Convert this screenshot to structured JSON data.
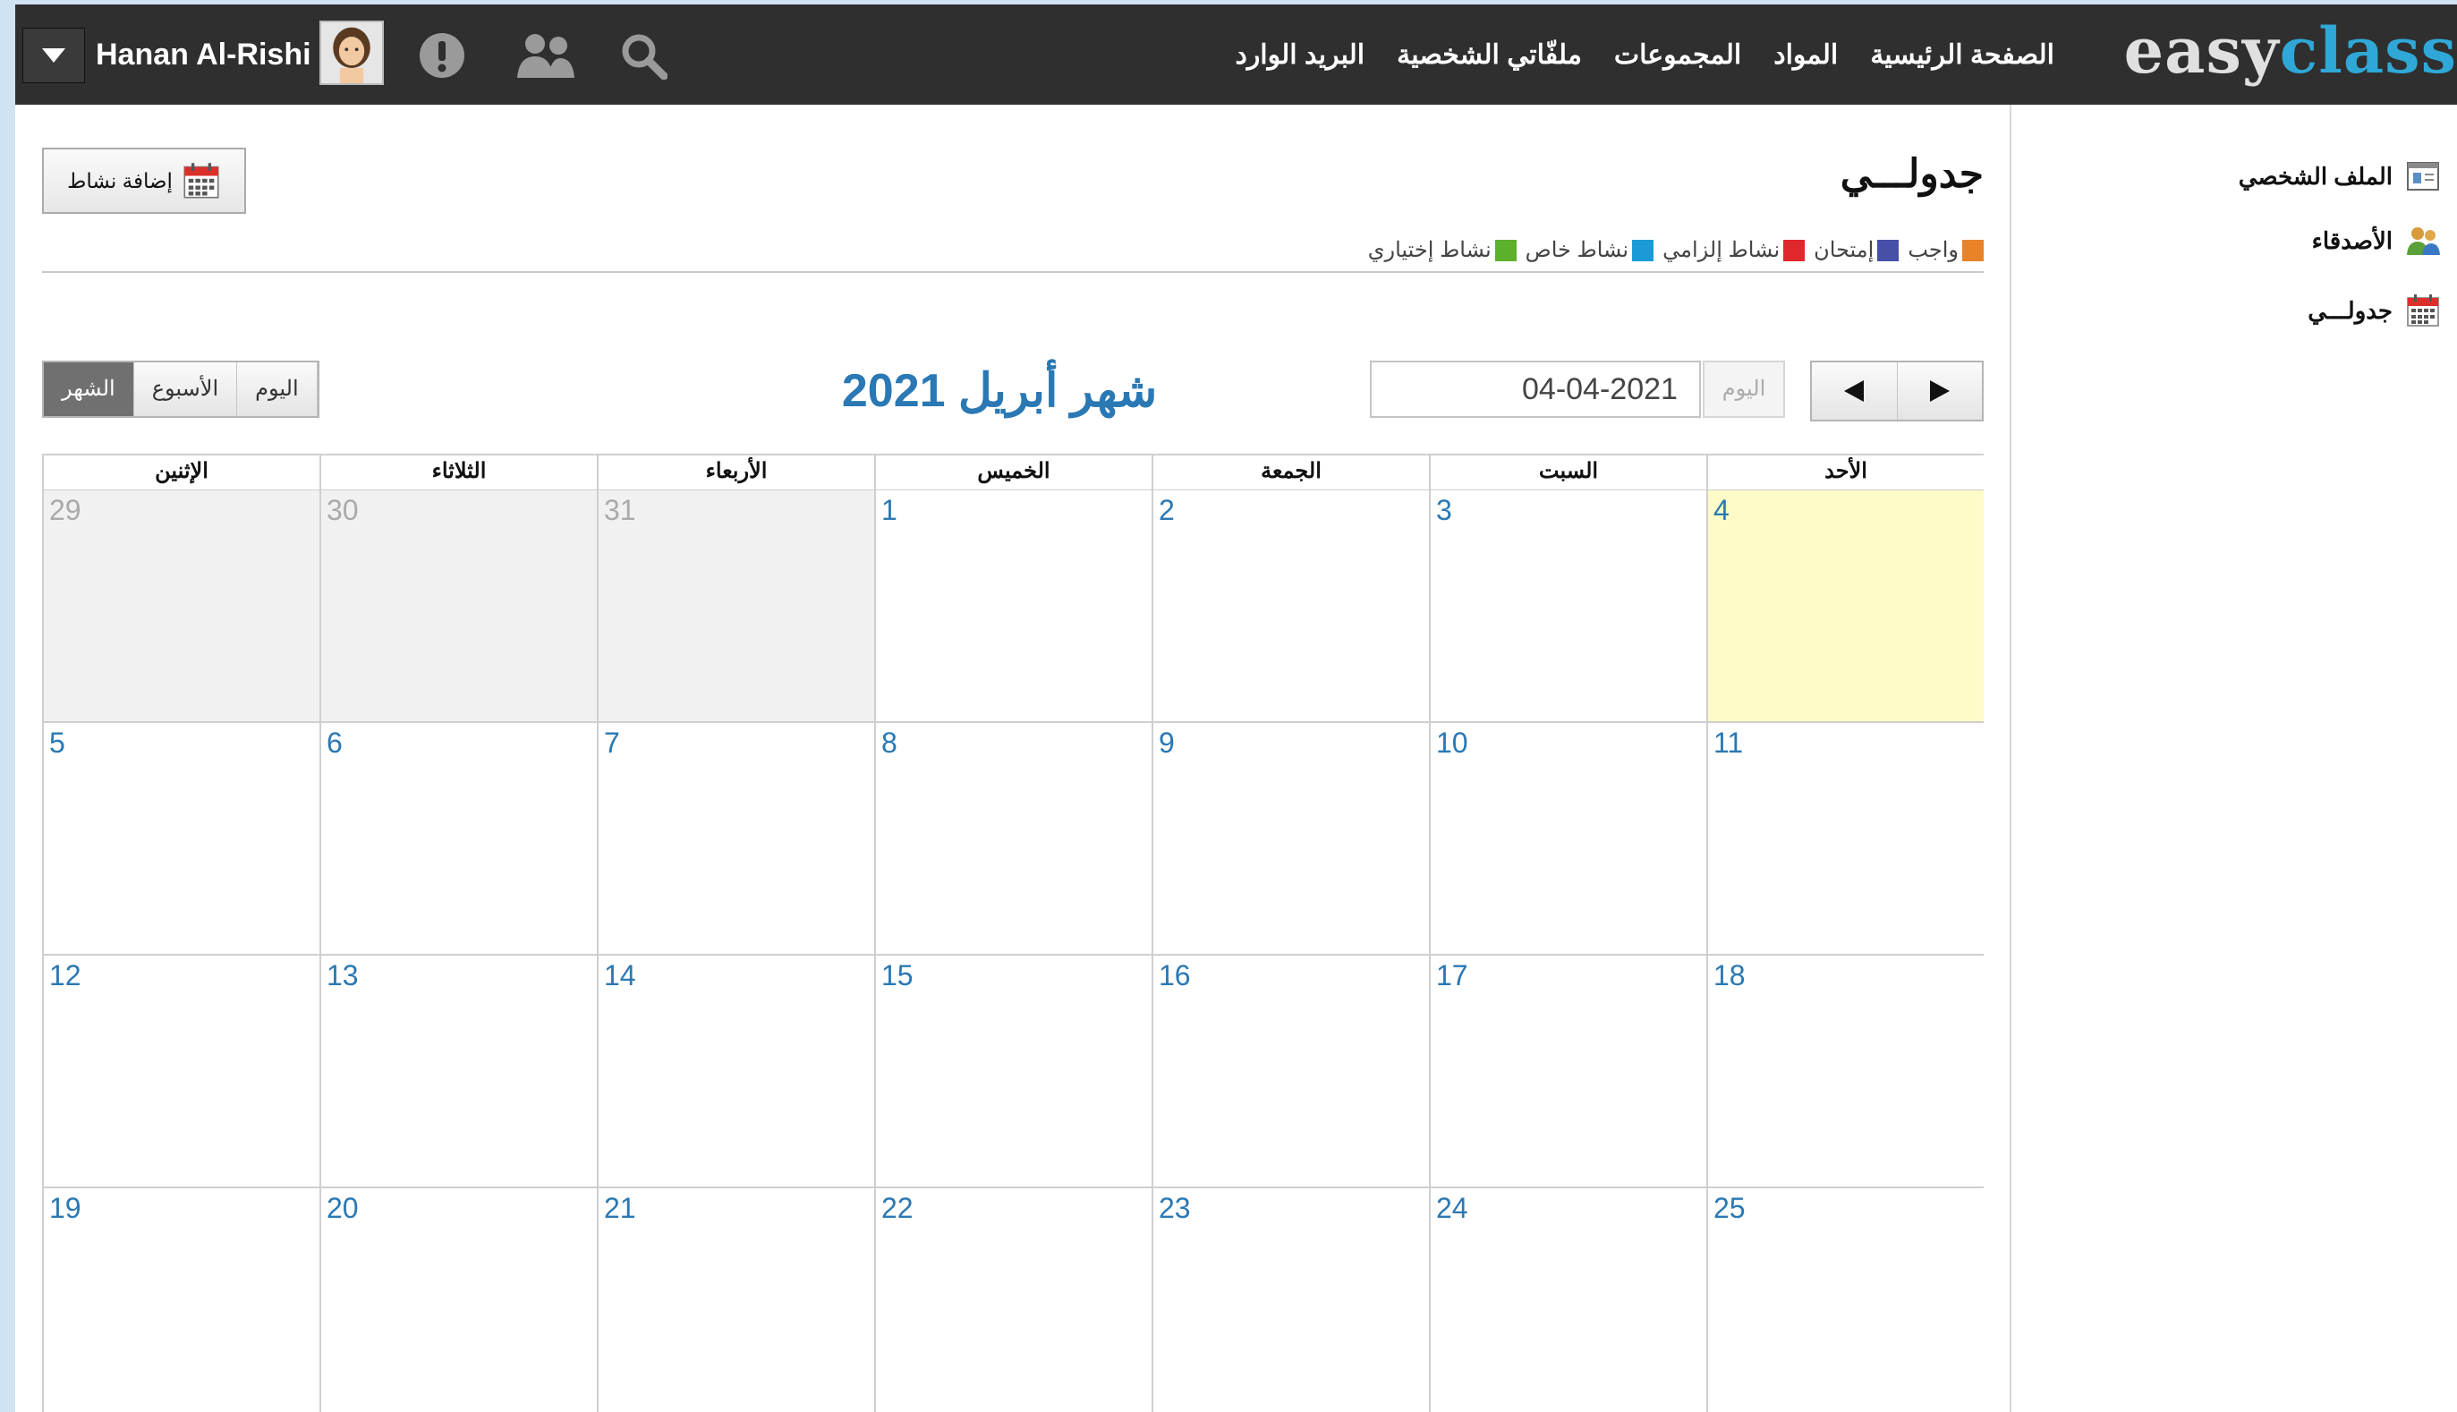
{
  "topbar": {
    "logo_part1": "easy",
    "logo_part2": "class",
    "nav": [
      "الصفحة الرئيسية",
      "المواد",
      "المجموعات",
      "ملفّاتي الشخصية",
      "البريد الوارد"
    ],
    "username": "Hanan Al-Rishi",
    "icons": [
      "caret-down-icon",
      "avatar",
      "alert-icon",
      "friends-icon",
      "search-icon"
    ]
  },
  "sidebar": {
    "items": [
      {
        "label": "الملف الشخصي",
        "icon": "profile-card-icon"
      },
      {
        "label": "الأصدقاء",
        "icon": "friends-icon"
      },
      {
        "label": "جدولـــي",
        "icon": "calendar-icon"
      }
    ]
  },
  "main": {
    "add_activity_label": "إضافة نشاط",
    "page_title": "جدولـــي",
    "legend": [
      {
        "label": "واجب",
        "color": "#e8832a"
      },
      {
        "label": "إمتحان",
        "color": "#4650a8"
      },
      {
        "label": "نشاط إلزامي",
        "color": "#e0282c"
      },
      {
        "label": "نشاط خاص",
        "color": "#1c9ad8"
      },
      {
        "label": "نشاط إختياري",
        "color": "#5cb02c"
      }
    ],
    "views": [
      "الشهر",
      "الأسبوع",
      "اليوم"
    ],
    "active_view": "الشهر",
    "month_title": "شهر أبريل 2021",
    "today_label": "اليوم",
    "date_value": "04-04-2021"
  },
  "calendar": {
    "weekdays": [
      "الأحد",
      "السبت",
      "الجمعة",
      "الخميس",
      "الأربعاء",
      "الثلاثاء",
      "الإثنين"
    ],
    "weeks": [
      [
        "4",
        "3",
        "2",
        "1",
        "31",
        "30",
        "29"
      ],
      [
        "11",
        "10",
        "9",
        "8",
        "7",
        "6",
        "5"
      ],
      [
        "18",
        "17",
        "16",
        "15",
        "14",
        "13",
        "12"
      ],
      [
        "25",
        "24",
        "23",
        "22",
        "21",
        "20",
        "19"
      ]
    ],
    "other_month": [
      "31",
      "30",
      "29"
    ],
    "today": "4"
  }
}
